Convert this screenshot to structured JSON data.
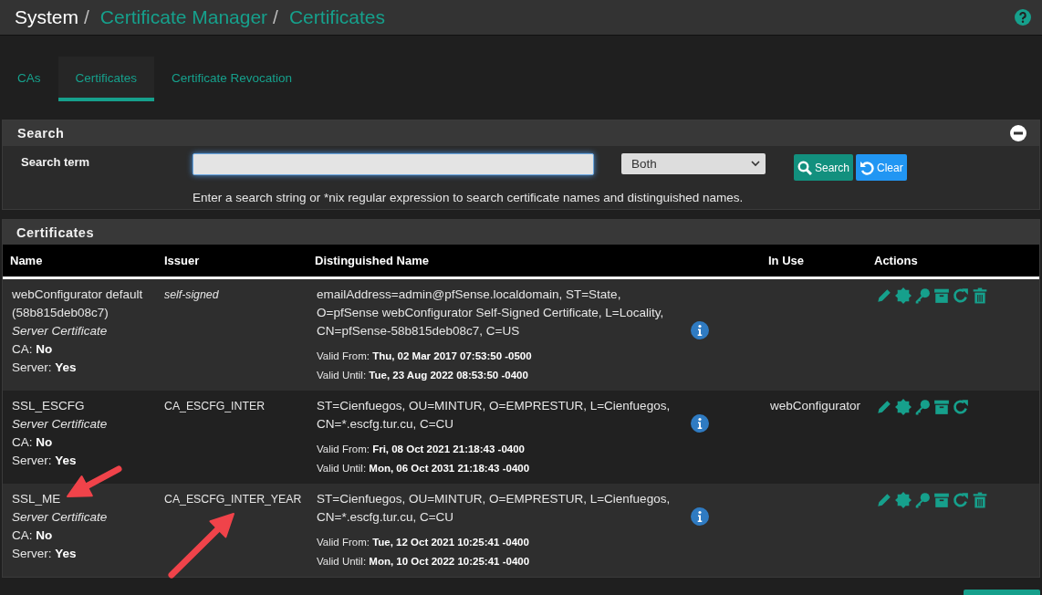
{
  "breadcrumb": [
    {
      "kind": "text",
      "label": "System"
    },
    {
      "kind": "separator",
      "label": "/"
    },
    {
      "kind": "link",
      "label": "Certificate Manager"
    },
    {
      "kind": "separator",
      "label": "/"
    },
    {
      "kind": "link",
      "label": "Certificates"
    }
  ],
  "tabs": [
    {
      "label": "CAs",
      "selected": false
    },
    {
      "label": "Certificates",
      "selected": true
    },
    {
      "label": "Certificate Revocation",
      "selected": false
    }
  ],
  "search_panel": {
    "title": "Search",
    "label": "Search term",
    "scope": "Both",
    "search_button": "Search",
    "clear_button": "Clear",
    "help": "Enter a search string or *nix regular expression to search certificate names and distinguished names."
  },
  "certificates": {
    "title": "Certificates",
    "columns": [
      "Name",
      "Issuer",
      "Distinguished Name",
      "In Use",
      "Actions"
    ],
    "rows": [
      {
        "name": "webConfigurator default (58b815deb08c7)",
        "type": "Server Certificate",
        "ca": "CA: **No**",
        "server": "Server: **Yes**",
        "issuer": "self-signed",
        "issuer_self": true,
        "dn": "emailAddress=admin@pfSense.localdomain, ST=State, O=pfSense webConfigurator Self-Signed Certificate, L=Locality, CN=pfSense-58b815deb08c7, C=US",
        "valid_from": "Valid From: **Thu, 02 Mar 2017 07:53:50 -0500**",
        "valid_until": "Valid Until: **Tue, 23 Aug 2022 08:53:50 -0400**",
        "actions": [
          {
            "kind": "edit"
          },
          {
            "kind": "issue"
          },
          {
            "kind": "key"
          },
          {
            "kind": "export"
          },
          {
            "kind": "renew"
          },
          {
            "kind": "delete"
          }
        ]
      },
      {
        "name": "SSL_ESCFG",
        "type": "Server Certificate",
        "ca": "CA: **No**",
        "server": "Server: **Yes**",
        "issuer": "CA_ESCFG_INTER",
        "issuer_self": false,
        "dn": "ST=Cienfuegos, OU=MINTUR, O=EMPRESTUR, L=Cienfuegos, CN=*.escfg.tur.cu, C=CU",
        "valid_from": "Valid From: **Fri, 08 Oct 2021 21:18:43 -0400**",
        "valid_until": "Valid Until: **Mon, 06 Oct 2031 21:18:43 -0400**",
        "in_use": "webConfigurator",
        "actions": [
          {
            "kind": "edit"
          },
          {
            "kind": "issue"
          },
          {
            "kind": "key"
          },
          {
            "kind": "export"
          },
          {
            "kind": "renew"
          }
        ]
      },
      {
        "name": "SSL_ME",
        "type": "Server Certificate",
        "ca": "CA: **No**",
        "server": "Server: **Yes**",
        "issuer": "CA_ESCFG_INTER_YEAR",
        "issuer_self": false,
        "dn": "ST=Cienfuegos, OU=MINTUR, O=EMPRESTUR, L=Cienfuegos, CN=*.escfg.tur.cu, C=CU",
        "valid_from": "Valid From: **Tue, 12 Oct 2021 10:25:41 -0400**",
        "valid_until": "Valid Until: **Mon, 10 Oct 2022 10:25:41 -0400**",
        "actions": [
          {
            "kind": "edit"
          },
          {
            "kind": "issue"
          },
          {
            "kind": "key"
          },
          {
            "kind": "export"
          },
          {
            "kind": "renew"
          },
          {
            "kind": "delete"
          }
        ]
      }
    ]
  },
  "annotations": [
    {
      "kind": "arrow",
      "color": "#f0434a"
    },
    {
      "kind": "arrow",
      "color": "#f0434a"
    }
  ]
}
